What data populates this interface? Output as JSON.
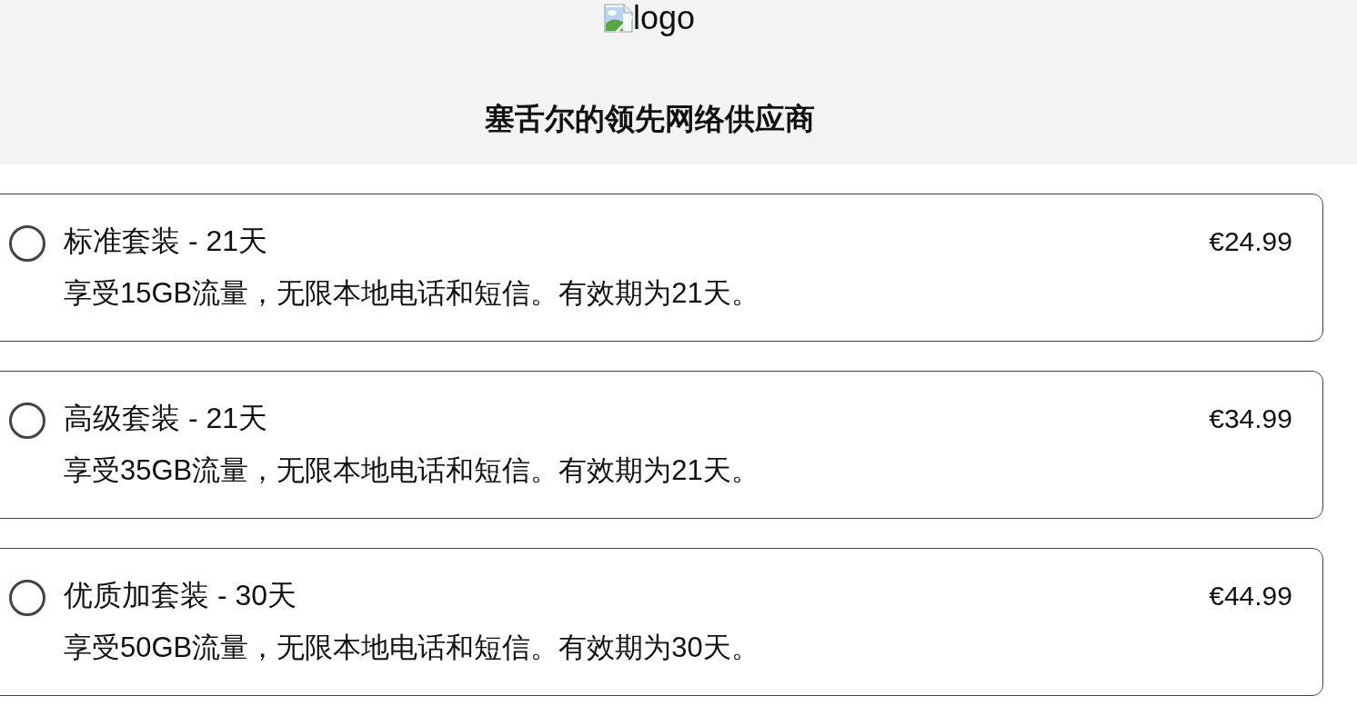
{
  "header": {
    "logo": {
      "alt": "logo"
    },
    "title": "塞舌尔的领先网络供应商"
  },
  "plans": [
    {
      "name": "标准套装 - 21天",
      "price": "€24.99",
      "description": "享受15GB流量，无限本地电话和短信。有效期为21天。",
      "selected": false
    },
    {
      "name": "高级套装 - 21天",
      "price": "€34.99",
      "description": "享受35GB流量，无限本地电话和短信。有效期为21天。",
      "selected": false
    },
    {
      "name": "优质加套装 - 30天",
      "price": "€44.99",
      "description": "享受50GB流量，无限本地电话和短信。有效期为30天。",
      "selected": false
    }
  ]
}
